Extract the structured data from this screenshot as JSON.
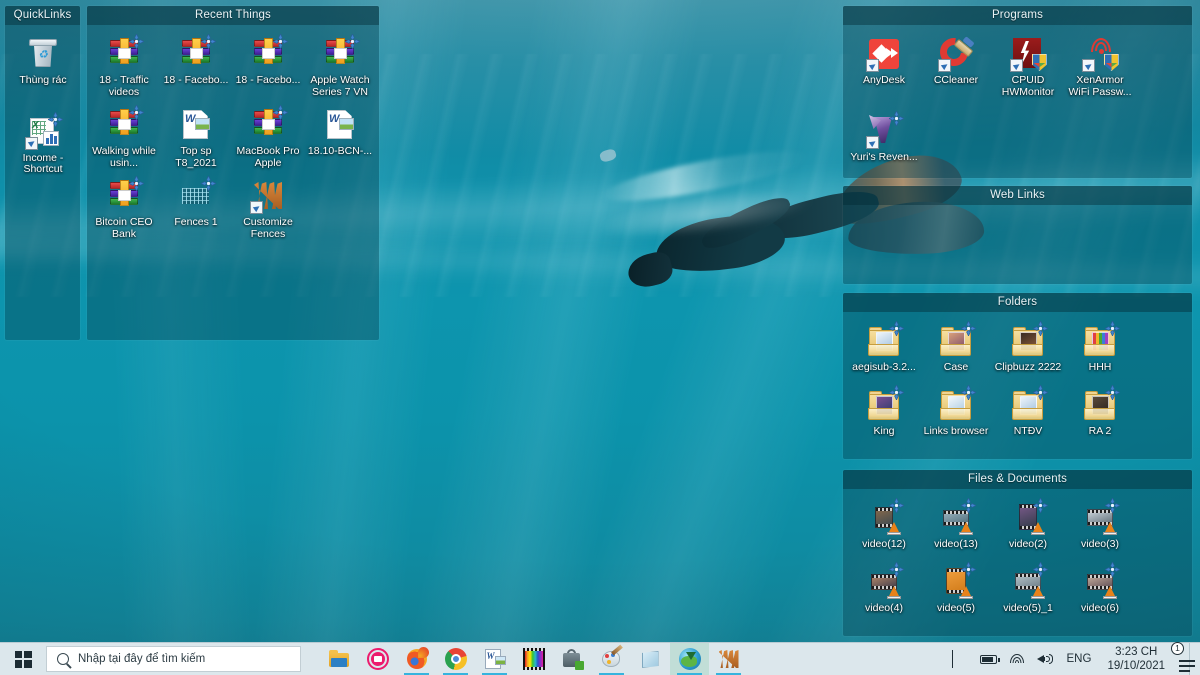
{
  "wallpaper": {
    "description": "underwater freediver with fins near surface",
    "accent": "#0f90aa"
  },
  "fences": [
    {
      "id": "quicklinks",
      "title": "QuickLinks",
      "items": [
        {
          "label": "Thùng rác",
          "icon": "recycle-bin-icon"
        },
        {
          "label": "Income - Shortcut",
          "icon": "excel-shortcut-icon"
        }
      ]
    },
    {
      "id": "recent-things",
      "title": "Recent Things",
      "items": [
        {
          "label": "18 - Traffic videos",
          "icon": "winrar-archive-icon"
        },
        {
          "label": "18 - Facebo...",
          "icon": "winrar-archive-icon"
        },
        {
          "label": "18 - Facebo...",
          "icon": "winrar-archive-icon"
        },
        {
          "label": "Apple Watch Series 7 VN",
          "icon": "winrar-archive-icon"
        },
        {
          "label": "Walking while usin...",
          "icon": "winrar-archive-icon"
        },
        {
          "label": "Top sp T8_2021",
          "icon": "word-document-icon"
        },
        {
          "label": "MacBook Pro Apple",
          "icon": "winrar-archive-icon"
        },
        {
          "label": "18.10-BCN-...",
          "icon": "word-document-icon"
        },
        {
          "label": "Bitcoin CEO Bank",
          "icon": "winrar-archive-icon"
        },
        {
          "label": "Fences 1",
          "icon": "fences-layout-icon"
        },
        {
          "label": "Customize Fences",
          "icon": "fences-app-shortcut-icon"
        }
      ]
    },
    {
      "id": "programs",
      "title": "Programs",
      "items": [
        {
          "label": "AnyDesk",
          "icon": "anydesk-icon"
        },
        {
          "label": "CCleaner",
          "icon": "ccleaner-icon"
        },
        {
          "label": "CPUID HWMonitor",
          "icon": "cpuid-hwmonitor-icon"
        },
        {
          "label": "XenArmor WiFi Passw...",
          "icon": "xenarmor-wifi-icon"
        },
        {
          "label": "Yuri's Reven...",
          "icon": "yuris-revenge-icon"
        }
      ]
    },
    {
      "id": "web-links",
      "title": "Web Links",
      "items": []
    },
    {
      "id": "folders",
      "title": "Folders",
      "items": [
        {
          "label": "aegisub-3.2...",
          "icon": "folder-icon"
        },
        {
          "label": "Case",
          "icon": "folder-icon"
        },
        {
          "label": "Clipbuzz 2222",
          "icon": "folder-icon"
        },
        {
          "label": "HHH",
          "icon": "folder-icon"
        },
        {
          "label": "King",
          "icon": "folder-icon"
        },
        {
          "label": "Links browser",
          "icon": "folder-icon"
        },
        {
          "label": "NTĐV",
          "icon": "folder-icon"
        },
        {
          "label": "RA 2",
          "icon": "folder-icon"
        }
      ]
    },
    {
      "id": "files-documents",
      "title": "Files & Documents",
      "items": [
        {
          "label": "video(12)",
          "icon": "video-file-icon"
        },
        {
          "label": "video(13)",
          "icon": "video-file-icon"
        },
        {
          "label": "video(2)",
          "icon": "video-file-icon"
        },
        {
          "label": "video(3)",
          "icon": "video-file-icon"
        },
        {
          "label": "video(4)",
          "icon": "video-file-icon"
        },
        {
          "label": "video(5)",
          "icon": "video-file-icon"
        },
        {
          "label": "video(5)_1",
          "icon": "video-file-icon"
        },
        {
          "label": "video(6)",
          "icon": "video-file-icon"
        }
      ]
    }
  ],
  "taskbar": {
    "start_label": "Start",
    "search": {
      "placeholder": "Nhập tại đây để tìm kiếm",
      "value": ""
    },
    "apps": [
      {
        "name": "file-explorer",
        "label": "File Explorer",
        "running": false,
        "active": false
      },
      {
        "name": "camera-recorder",
        "label": "Camera",
        "running": false,
        "active": false
      },
      {
        "name": "firefox",
        "label": "Mozilla Firefox",
        "running": true,
        "active": false
      },
      {
        "name": "chrome",
        "label": "Google Chrome",
        "running": true,
        "active": false
      },
      {
        "name": "word",
        "label": "Microsoft Word",
        "running": true,
        "active": false
      },
      {
        "name": "color-picker",
        "label": "Color Picker",
        "running": false,
        "active": false
      },
      {
        "name": "lock-tool",
        "label": "Lock Tool",
        "running": false,
        "active": false
      },
      {
        "name": "paint",
        "label": "Paint",
        "running": true,
        "active": false
      },
      {
        "name": "notepad",
        "label": "Notepad",
        "running": false,
        "active": false
      },
      {
        "name": "download-manager",
        "label": "Internet Download Manager",
        "running": true,
        "active": true
      },
      {
        "name": "fences",
        "label": "Fences",
        "running": true,
        "active": false
      }
    ],
    "tray": {
      "overflow_label": "Show hidden icons",
      "battery_label": "Battery",
      "network_label": "Network",
      "volume_label": "Volume",
      "language": "ENG",
      "time": "3:23 CH",
      "date": "19/10/2021",
      "notification_count": "1"
    }
  }
}
